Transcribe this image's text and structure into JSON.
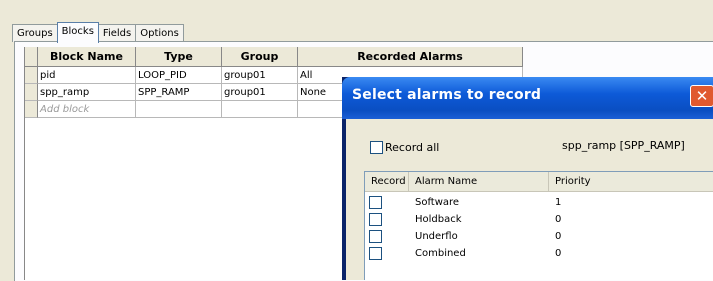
{
  "tabs": [
    {
      "label": "Groups"
    },
    {
      "label": "Blocks"
    },
    {
      "label": "Fields"
    },
    {
      "label": "Options"
    }
  ],
  "grid": {
    "headers": [
      "Block Name",
      "Type",
      "Group",
      "Recorded Alarms"
    ],
    "rows": [
      {
        "name": "pid",
        "type": "LOOP_PID",
        "group": "group01",
        "alarms": "All"
      },
      {
        "name": "spp_ramp",
        "type": "SPP_RAMP",
        "group": "group01",
        "alarms": "None"
      }
    ],
    "add_placeholder": "Add block"
  },
  "dialog": {
    "title": "Select alarms to record",
    "close_glyph": "✕",
    "record_all_label": "Record all",
    "block_ref": "spp_ramp [SPP_RAMP]",
    "headers": [
      "Record",
      "Alarm Name",
      "Priority"
    ],
    "alarms": [
      {
        "name": "Software",
        "priority": "1"
      },
      {
        "name": "Holdback",
        "priority": "0"
      },
      {
        "name": "Underflo",
        "priority": "0"
      },
      {
        "name": "Combined",
        "priority": "0"
      }
    ]
  },
  "colors": {
    "title_bar": "#0d5ad8",
    "close_button": "#e0592f",
    "window_bg": "#ece9d8"
  }
}
